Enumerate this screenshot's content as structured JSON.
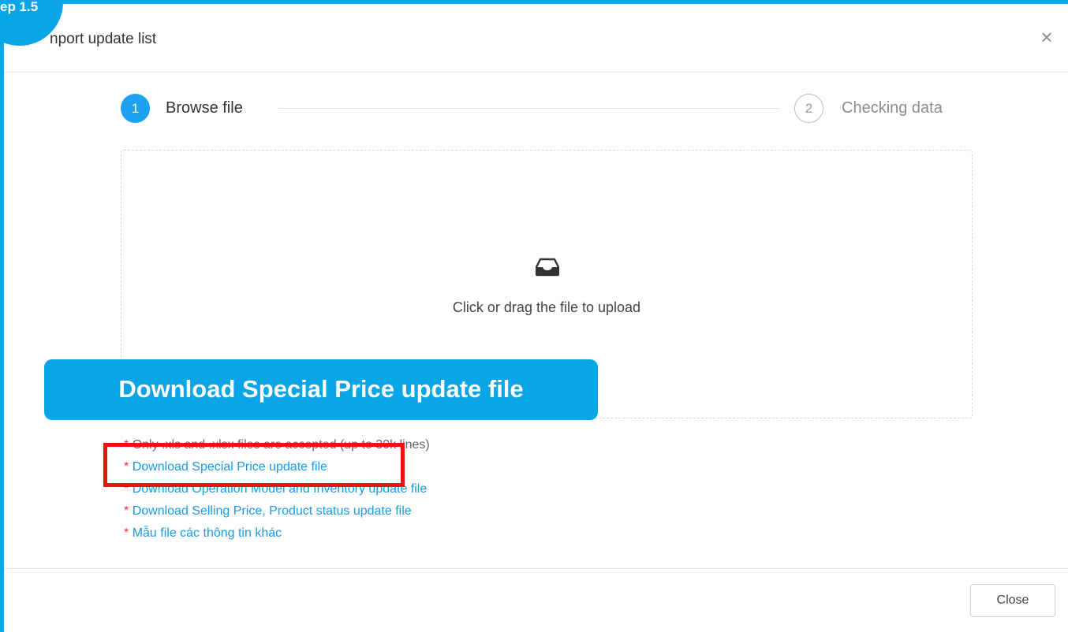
{
  "badge": {
    "label": "ep 1.5"
  },
  "modal": {
    "title": "nport update list",
    "close_icon": "×"
  },
  "steps": [
    {
      "number": "1",
      "label": "Browse file",
      "state": "active"
    },
    {
      "number": "2",
      "label": "Checking data",
      "state": "pending"
    }
  ],
  "dropzone": {
    "icon": "inbox-icon",
    "text": "Click or drag the file to upload"
  },
  "notes": {
    "star": "*",
    "accepted": "Only .xls and .xlsx files are accepted (up to 30k lines)",
    "links": [
      "Download Special Price update file",
      "Download Operation Model and Inventory update file",
      "Download Selling Price, Product status update file",
      "Mẫu file các thông tin khác"
    ]
  },
  "callout": {
    "text": "Download Special Price update file"
  },
  "footer": {
    "close_label": "Close"
  },
  "colors": {
    "accent": "#0aa5e6",
    "step_active": "#1aa1f0",
    "link": "#1a9ae6",
    "required_star": "#e8302f",
    "highlight": "#ee1111"
  }
}
